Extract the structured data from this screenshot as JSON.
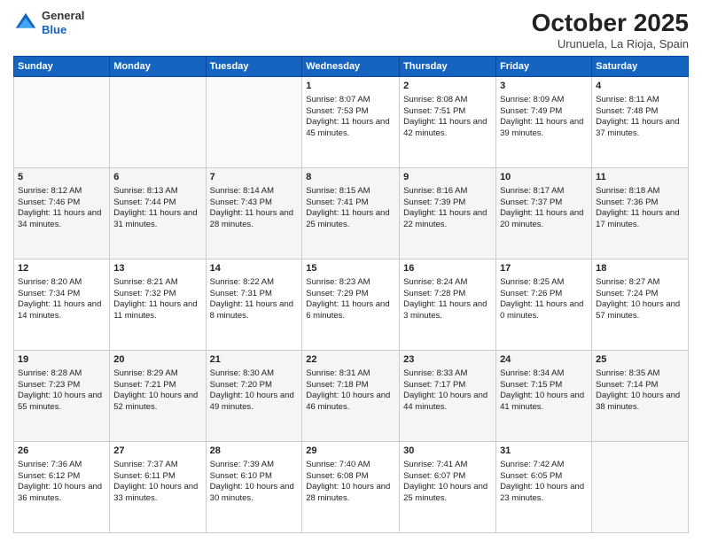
{
  "header": {
    "logo_line1": "General",
    "logo_line2": "Blue",
    "month_title": "October 2025",
    "location": "Urunuela, La Rioja, Spain"
  },
  "weekdays": [
    "Sunday",
    "Monday",
    "Tuesday",
    "Wednesday",
    "Thursday",
    "Friday",
    "Saturday"
  ],
  "weeks": [
    [
      {
        "day": "",
        "info": ""
      },
      {
        "day": "",
        "info": ""
      },
      {
        "day": "",
        "info": ""
      },
      {
        "day": "1",
        "info": "Sunrise: 8:07 AM\nSunset: 7:53 PM\nDaylight: 11 hours and 45 minutes."
      },
      {
        "day": "2",
        "info": "Sunrise: 8:08 AM\nSunset: 7:51 PM\nDaylight: 11 hours and 42 minutes."
      },
      {
        "day": "3",
        "info": "Sunrise: 8:09 AM\nSunset: 7:49 PM\nDaylight: 11 hours and 39 minutes."
      },
      {
        "day": "4",
        "info": "Sunrise: 8:11 AM\nSunset: 7:48 PM\nDaylight: 11 hours and 37 minutes."
      }
    ],
    [
      {
        "day": "5",
        "info": "Sunrise: 8:12 AM\nSunset: 7:46 PM\nDaylight: 11 hours and 34 minutes."
      },
      {
        "day": "6",
        "info": "Sunrise: 8:13 AM\nSunset: 7:44 PM\nDaylight: 11 hours and 31 minutes."
      },
      {
        "day": "7",
        "info": "Sunrise: 8:14 AM\nSunset: 7:43 PM\nDaylight: 11 hours and 28 minutes."
      },
      {
        "day": "8",
        "info": "Sunrise: 8:15 AM\nSunset: 7:41 PM\nDaylight: 11 hours and 25 minutes."
      },
      {
        "day": "9",
        "info": "Sunrise: 8:16 AM\nSunset: 7:39 PM\nDaylight: 11 hours and 22 minutes."
      },
      {
        "day": "10",
        "info": "Sunrise: 8:17 AM\nSunset: 7:37 PM\nDaylight: 11 hours and 20 minutes."
      },
      {
        "day": "11",
        "info": "Sunrise: 8:18 AM\nSunset: 7:36 PM\nDaylight: 11 hours and 17 minutes."
      }
    ],
    [
      {
        "day": "12",
        "info": "Sunrise: 8:20 AM\nSunset: 7:34 PM\nDaylight: 11 hours and 14 minutes."
      },
      {
        "day": "13",
        "info": "Sunrise: 8:21 AM\nSunset: 7:32 PM\nDaylight: 11 hours and 11 minutes."
      },
      {
        "day": "14",
        "info": "Sunrise: 8:22 AM\nSunset: 7:31 PM\nDaylight: 11 hours and 8 minutes."
      },
      {
        "day": "15",
        "info": "Sunrise: 8:23 AM\nSunset: 7:29 PM\nDaylight: 11 hours and 6 minutes."
      },
      {
        "day": "16",
        "info": "Sunrise: 8:24 AM\nSunset: 7:28 PM\nDaylight: 11 hours and 3 minutes."
      },
      {
        "day": "17",
        "info": "Sunrise: 8:25 AM\nSunset: 7:26 PM\nDaylight: 11 hours and 0 minutes."
      },
      {
        "day": "18",
        "info": "Sunrise: 8:27 AM\nSunset: 7:24 PM\nDaylight: 10 hours and 57 minutes."
      }
    ],
    [
      {
        "day": "19",
        "info": "Sunrise: 8:28 AM\nSunset: 7:23 PM\nDaylight: 10 hours and 55 minutes."
      },
      {
        "day": "20",
        "info": "Sunrise: 8:29 AM\nSunset: 7:21 PM\nDaylight: 10 hours and 52 minutes."
      },
      {
        "day": "21",
        "info": "Sunrise: 8:30 AM\nSunset: 7:20 PM\nDaylight: 10 hours and 49 minutes."
      },
      {
        "day": "22",
        "info": "Sunrise: 8:31 AM\nSunset: 7:18 PM\nDaylight: 10 hours and 46 minutes."
      },
      {
        "day": "23",
        "info": "Sunrise: 8:33 AM\nSunset: 7:17 PM\nDaylight: 10 hours and 44 minutes."
      },
      {
        "day": "24",
        "info": "Sunrise: 8:34 AM\nSunset: 7:15 PM\nDaylight: 10 hours and 41 minutes."
      },
      {
        "day": "25",
        "info": "Sunrise: 8:35 AM\nSunset: 7:14 PM\nDaylight: 10 hours and 38 minutes."
      }
    ],
    [
      {
        "day": "26",
        "info": "Sunrise: 7:36 AM\nSunset: 6:12 PM\nDaylight: 10 hours and 36 minutes."
      },
      {
        "day": "27",
        "info": "Sunrise: 7:37 AM\nSunset: 6:11 PM\nDaylight: 10 hours and 33 minutes."
      },
      {
        "day": "28",
        "info": "Sunrise: 7:39 AM\nSunset: 6:10 PM\nDaylight: 10 hours and 30 minutes."
      },
      {
        "day": "29",
        "info": "Sunrise: 7:40 AM\nSunset: 6:08 PM\nDaylight: 10 hours and 28 minutes."
      },
      {
        "day": "30",
        "info": "Sunrise: 7:41 AM\nSunset: 6:07 PM\nDaylight: 10 hours and 25 minutes."
      },
      {
        "day": "31",
        "info": "Sunrise: 7:42 AM\nSunset: 6:05 PM\nDaylight: 10 hours and 23 minutes."
      },
      {
        "day": "",
        "info": ""
      }
    ]
  ]
}
